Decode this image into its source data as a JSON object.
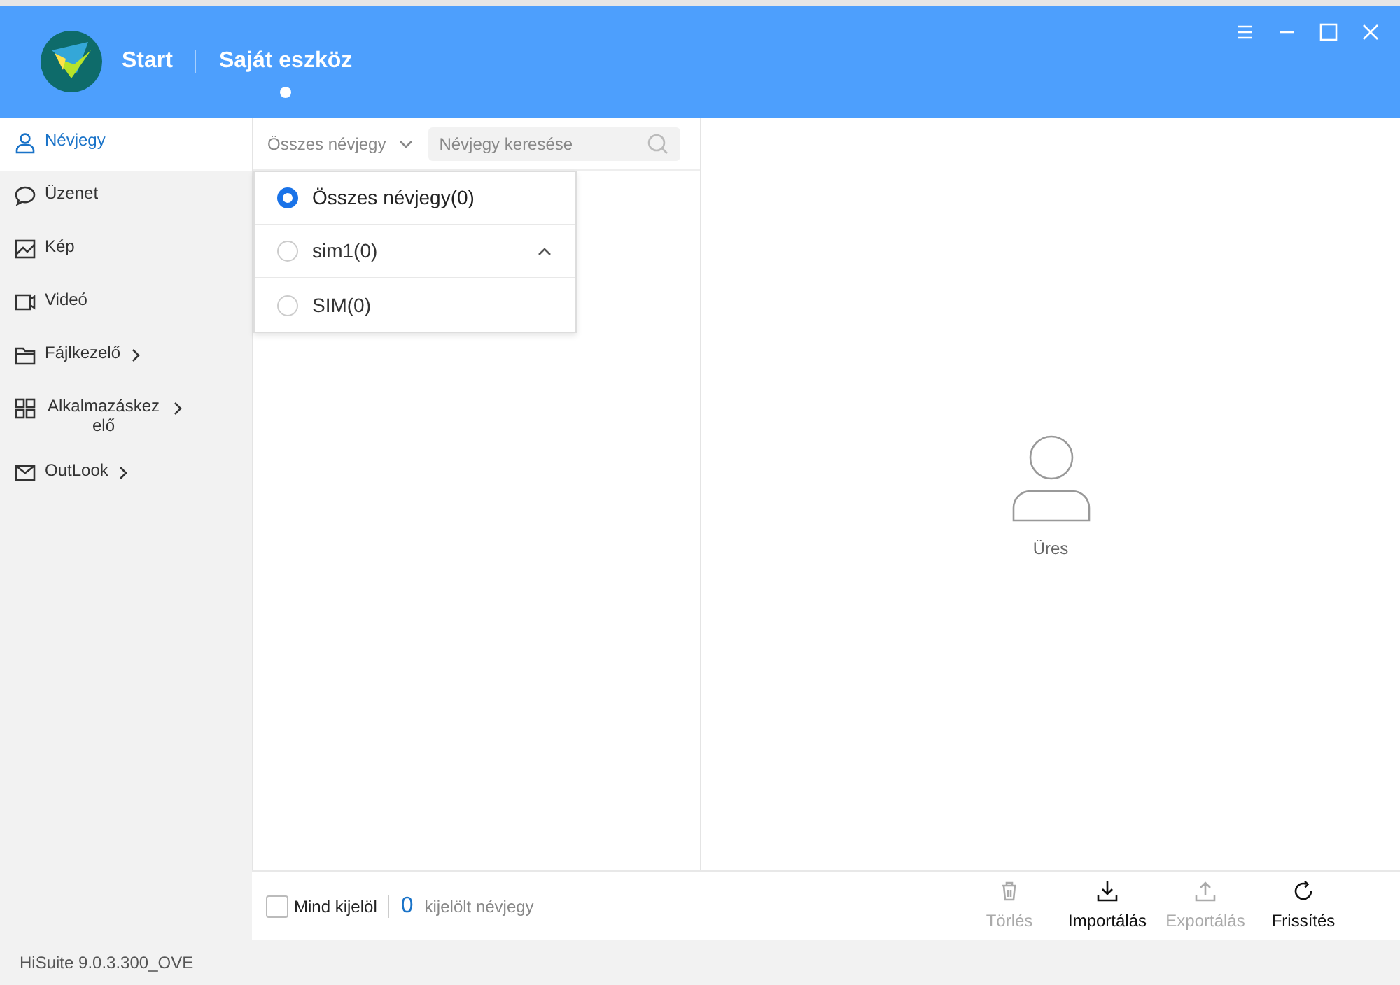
{
  "header": {
    "tabs": [
      {
        "label": "Start",
        "selected": false
      },
      {
        "label": "Saját eszköz",
        "selected": true
      }
    ]
  },
  "sidebar": {
    "items": [
      {
        "label": "Névjegy",
        "selected": true,
        "expandable": false
      },
      {
        "label": "Üzenet",
        "selected": false,
        "expandable": false
      },
      {
        "label": "Kép",
        "selected": false,
        "expandable": false
      },
      {
        "label": "Videó",
        "selected": false,
        "expandable": false
      },
      {
        "label": "Fájlkezelő",
        "selected": false,
        "expandable": true
      },
      {
        "label": "Alkalmazáskezelő",
        "selected": false,
        "expandable": true
      },
      {
        "label": "OutLook",
        "selected": false,
        "expandable": true
      }
    ]
  },
  "filter": {
    "value": "Összes névjegy",
    "placeholder": "Névjegy keresése"
  },
  "dropdown": {
    "options": [
      {
        "label": "Összes névjegy(0)",
        "selected": true
      },
      {
        "label": "sim1(0)",
        "selected": false,
        "expanded": true
      },
      {
        "label": "SIM(0)",
        "selected": false
      }
    ]
  },
  "detail": {
    "empty_text": "Üres"
  },
  "footer": {
    "select_all": {
      "label": "Mind kijelöl",
      "checked": false
    },
    "count": "0",
    "count_label": "kijelölt névjegy",
    "actions": [
      {
        "label": "Törlés",
        "disabled": true
      },
      {
        "label": "Importálás",
        "disabled": false
      },
      {
        "label": "Exportálás",
        "disabled": true
      },
      {
        "label": "Frissítés",
        "disabled": false
      }
    ]
  },
  "status_bar": "HiSuite 9.0.3.300_OVE"
}
